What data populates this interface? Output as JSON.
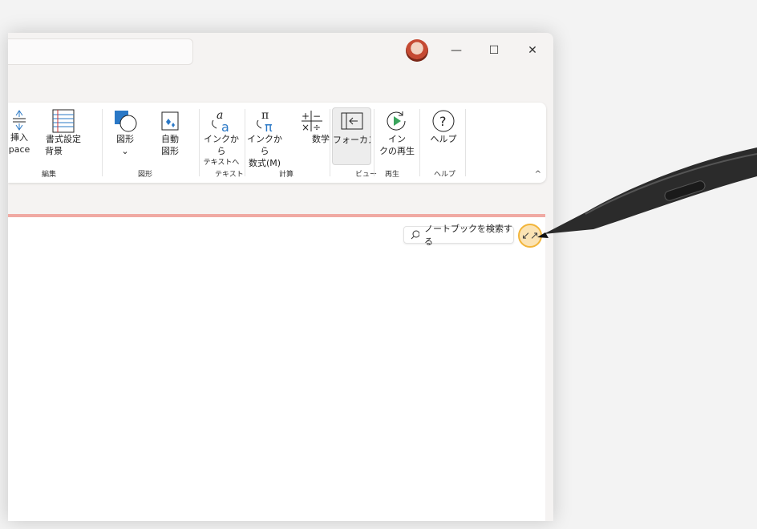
{
  "titlebar": {
    "search_value": "",
    "window_controls": {
      "minimize": "—",
      "maximize": "☐",
      "close": "✕"
    }
  },
  "ribbon": {
    "buttons": [
      {
        "key": "insert-space",
        "lines": [
          "挿入",
          "pace"
        ]
      },
      {
        "key": "format-bg",
        "lines": [
          "書式設定",
          "背景"
        ]
      },
      {
        "key": "shapes",
        "lines": [
          "図形",
          "⌄"
        ]
      },
      {
        "key": "auto-shapes",
        "lines": [
          "自動",
          "図形"
        ]
      },
      {
        "key": "ink-to-text",
        "lines": [
          "インクから",
          "テキストへ"
        ]
      },
      {
        "key": "ink-to-math",
        "lines": [
          "インクから",
          "数式(M)"
        ]
      },
      {
        "key": "math",
        "lines": [
          "数学"
        ]
      },
      {
        "key": "focus",
        "lines": [
          "フォーカス"
        ]
      },
      {
        "key": "ink-replay",
        "lines": [
          "イン",
          "クの再生"
        ]
      },
      {
        "key": "help",
        "lines": [
          "ヘルプ"
        ]
      }
    ],
    "groups": [
      "編集",
      "図形",
      "テキスト",
      "計算",
      "ビュー",
      "再生",
      "ヘルプ"
    ],
    "collapse": "^"
  },
  "page": {
    "search_placeholder": "ノートブックを検索する",
    "expand_icon": "↙↗"
  },
  "colors": {
    "accent": "#f0a9a3",
    "highlight": "#f2b53a",
    "icon_blue": "#2a78c6"
  }
}
